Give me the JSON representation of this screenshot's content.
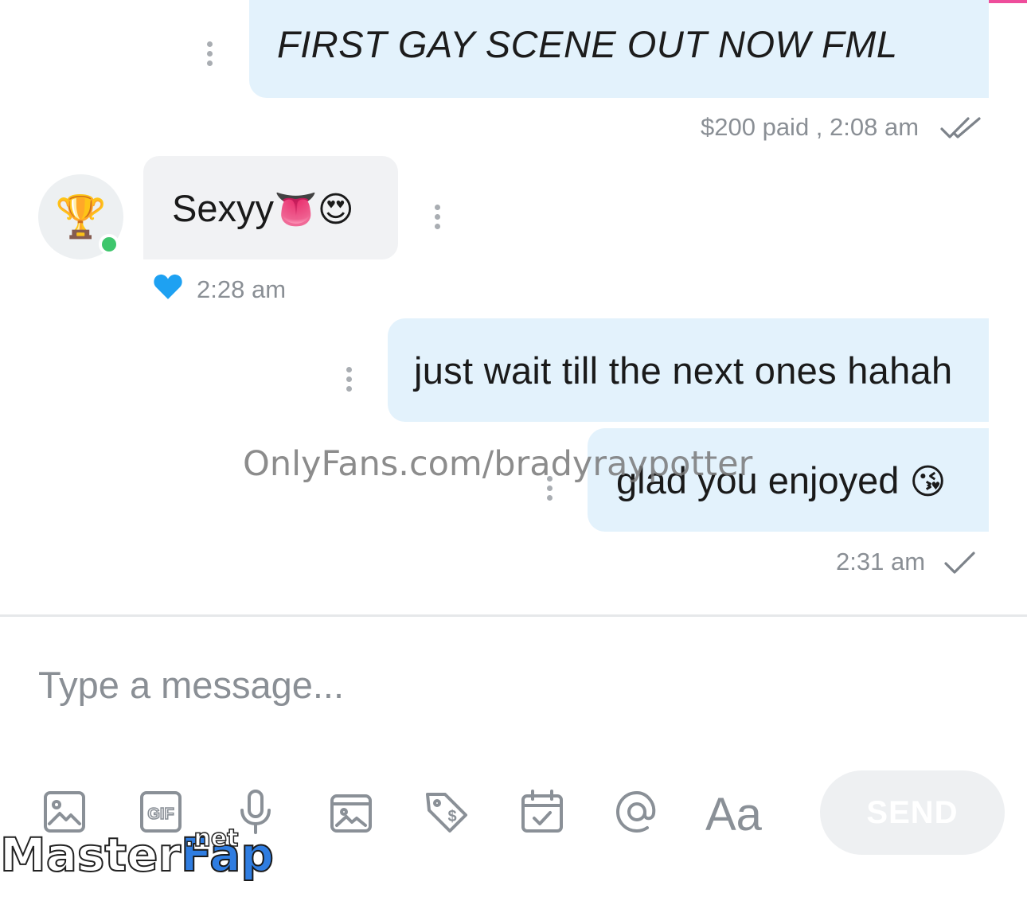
{
  "messages": [
    {
      "text": "FIRST GAY SCENE OUT NOW FML",
      "meta": "$200 paid , 2:08 am"
    },
    {
      "text": "Sexyy",
      "emoji": "👅😍",
      "meta": "2:28 am"
    },
    {
      "text": "just wait till the next ones hahah"
    },
    {
      "text": "glad you enjoyed",
      "emoji": "😘",
      "meta": "2:31 am"
    }
  ],
  "avatar": {
    "emoji": "🏆",
    "status": "online"
  },
  "watermark": "OnlyFans.com/bradyraypotter",
  "composer": {
    "placeholder": "Type a message...",
    "format_label": "Aa",
    "send_label": "SEND",
    "tools": [
      "image-icon",
      "gif-icon",
      "microphone-icon",
      "media-vault-icon",
      "price-tag-icon",
      "calendar-icon",
      "mention-icon",
      "text-format-icon"
    ]
  },
  "logo": {
    "part1": "Master",
    "part2": "Fap",
    "part3": ".net"
  },
  "colors": {
    "outgoing_bubble": "#e3f2fc",
    "incoming_bubble": "#f1f2f4",
    "online": "#3ec66c",
    "like_heart": "#1ea1f2",
    "accent_bar": "#ee4d9b"
  }
}
